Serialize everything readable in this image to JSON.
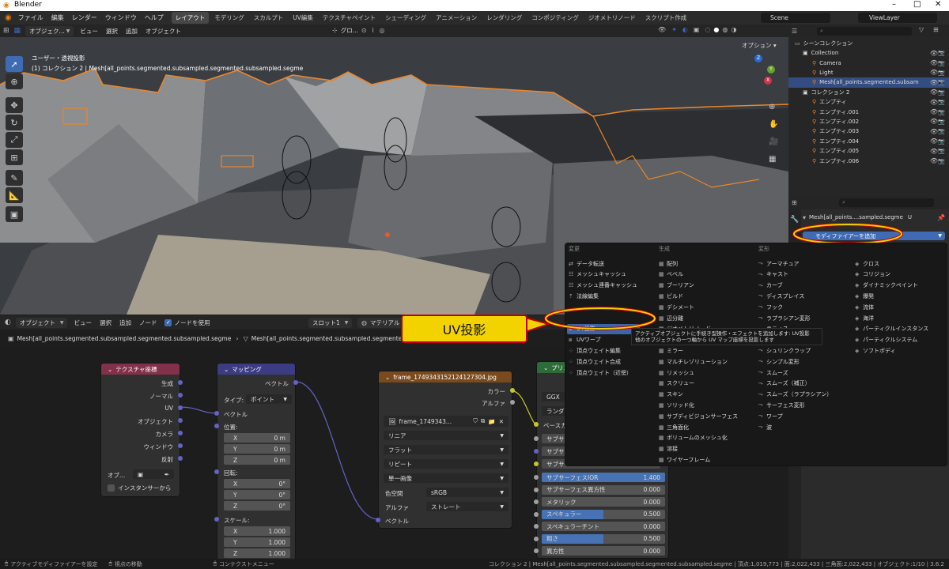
{
  "app": {
    "title": "Blender"
  },
  "window_controls": {
    "minimize": "–",
    "maximize": "□",
    "close": "✕"
  },
  "menu": {
    "items": [
      "ファイル",
      "編集",
      "レンダー",
      "ウィンドウ",
      "ヘルプ"
    ],
    "workspaces": [
      "レイアウト",
      "モデリング",
      "スカルプト",
      "UV編集",
      "テクスチャペイント",
      "シェーディング",
      "アニメーション",
      "レンダリング",
      "コンポジティング",
      "ジオメトリノード",
      "スクリプト作成"
    ],
    "active_workspace": "レイアウト",
    "scene": "Scene",
    "view_layer": "ViewLayer"
  },
  "viewport": {
    "mode": "オブジェク...",
    "header_menus": [
      "ビュー",
      "選択",
      "追加",
      "オブジェクト"
    ],
    "transform_orientation": "グロ...",
    "options_label": "オプション",
    "view_name": "ユーザー・透視投影",
    "collection_info": "(1) コレクション 2 | Mesh[all_points.segmented.subsampled.segmented.subsampled.segme",
    "gizmo_axes": {
      "z": "Z",
      "y": "Y",
      "x": "X"
    }
  },
  "outliner": {
    "title": "シーンコレクション",
    "items": [
      {
        "label": "Collection",
        "depth": 1
      },
      {
        "label": "Camera",
        "depth": 2
      },
      {
        "label": "Light",
        "depth": 2
      },
      {
        "label": "Mesh[all_points.segmented.subsam",
        "depth": 2,
        "selected": true
      },
      {
        "label": "コレクション 2",
        "depth": 1
      },
      {
        "label": "エンプティ",
        "depth": 2
      },
      {
        "label": "エンプティ.001",
        "depth": 2
      },
      {
        "label": "エンプティ.002",
        "depth": 2
      },
      {
        "label": "エンプティ.003",
        "depth": 2
      },
      {
        "label": "エンプティ.004",
        "depth": 2
      },
      {
        "label": "エンプティ.005",
        "depth": 2
      },
      {
        "label": "エンプティ.006",
        "depth": 2
      }
    ]
  },
  "properties": {
    "object_name": "Mesh[all_points....sampled.segme",
    "object_suffix": "U",
    "add_modifier": "モディファイアーを追加"
  },
  "modifier_menu": {
    "columns": [
      {
        "header": "変更",
        "items": [
          "データ転送",
          "メッシュキャッシュ",
          "メッシュ連番キャッシュ",
          "法線編集",
          "",
          "",
          "UV投影",
          "UVワープ",
          "頂点ウェイト編集",
          "頂点ウェイト合成",
          "頂点ウェイト（近傍）"
        ]
      },
      {
        "header": "生成",
        "items": [
          "配列",
          "ベベル",
          "ブーリアン",
          "ビルド",
          "デシメート",
          "辺分離",
          "ジオメトリノード",
          "マスク",
          "ミラー",
          "マルチレゾリューション",
          "リメッシュ",
          "スクリュー",
          "スキン",
          "ソリッド化",
          "サブディビジョンサーフェス",
          "三角面化",
          "ボリュームのメッシュ化",
          "溶接",
          "ワイヤーフレーム"
        ]
      },
      {
        "header": "変形",
        "items": [
          "アーマチュア",
          "キャスト",
          "カーブ",
          "ディスプレイス",
          "フック",
          "ラプラシアン変形",
          "ラティス",
          "メッシュ変形",
          "シュリンクラップ",
          "シンプル変形",
          "スムーズ",
          "スムーズ（補正）",
          "スムーズ（ラプラシアン）",
          "サーフェス変形",
          "ワープ",
          "波"
        ]
      },
      {
        "header": "",
        "items": [
          "クロス",
          "コリジョン",
          "ダイナミックペイント",
          "爆発",
          "流体",
          "海洋",
          "パーティクルインスタンス",
          "パーティクルシステム",
          "ソフトボディ"
        ]
      }
    ],
    "highlighted": "UV投影",
    "tooltip_line1": "アクティブオブジェクトに手続き型操作・エフェクトを追加します: UV投影",
    "tooltip_line2": "他のオブジェクトの一つ軸から UV マップ座標を投影します"
  },
  "callout": {
    "text": "UV投影"
  },
  "node_editor": {
    "header": {
      "mode": "オブジェクト",
      "menus": [
        "ビュー",
        "選択",
        "追加",
        "ノード"
      ],
      "use_nodes": "ノードを使用",
      "slot": "スロット1",
      "material": "マテリアル"
    },
    "breadcrumb_object": "Mesh[all_points.segmented.subsampled.segmented.subsampled.segme",
    "breadcrumb_mesh": "Mesh[all_points.segmented.subsampled.segmented.subsampled.segme",
    "texcoord": {
      "title": "テクスチャ座標",
      "outputs": [
        "生成",
        "ノーマル",
        "UV",
        "オブジェクト",
        "カメラ",
        "ウィンドウ",
        "反射"
      ],
      "object_label": "オブ...",
      "instancer": "インスタンサーから"
    },
    "mapping": {
      "title": "マッピング",
      "output": "ベクトル",
      "type_label": "タイプ:",
      "type_value": "ポイント",
      "vector": "ベクトル",
      "location": "位置:",
      "rotation": "回転:",
      "scale": "スケール:",
      "loc": [
        {
          "a": "X",
          "v": "0 m"
        },
        {
          "a": "Y",
          "v": "0 m"
        },
        {
          "a": "Z",
          "v": "0 m"
        }
      ],
      "rot": [
        {
          "a": "X",
          "v": "0°"
        },
        {
          "a": "Y",
          "v": "0°"
        },
        {
          "a": "Z",
          "v": "0°"
        }
      ],
      "scl": [
        {
          "a": "X",
          "v": "1.000"
        },
        {
          "a": "Y",
          "v": "1.000"
        },
        {
          "a": "Z",
          "v": "1.000"
        }
      ]
    },
    "image": {
      "title": "frame_1749343152124127304.jpg",
      "outputs": [
        "カラー",
        "アルファ"
      ],
      "image_name": "frame_1749343...",
      "interp": "リニア",
      "proj": "フラット",
      "ext": "リピート",
      "source": "単一画像",
      "cs_label": "色空間",
      "cs_value": "sRGB",
      "alpha_label": "アルファ",
      "alpha_value": "ストレート",
      "vector": "ベクトル"
    },
    "bsdf": {
      "title": "プリンシ...",
      "distribution": "GGX",
      "ssm": "ランダ...",
      "base_color": "ベースカ...",
      "rows": [
        "サブサ...",
        "サブサ...",
        "サブサー..."
      ],
      "props": [
        {
          "label": "サブサーフェスIOR",
          "value": "1.400",
          "fill": 1.0
        },
        {
          "label": "サブサーフェス異方性",
          "value": "0.000",
          "fill": 0
        },
        {
          "label": "メタリック",
          "value": "0.000",
          "fill": 0
        },
        {
          "label": "スペキュラー",
          "value": "0.500",
          "fill": 0.5
        },
        {
          "label": "スペキュラーチント",
          "value": "0.000",
          "fill": 0
        },
        {
          "label": "粗さ",
          "value": "0.500",
          "fill": 0.5
        },
        {
          "label": "異方性",
          "value": "0.000",
          "fill": 0
        }
      ]
    }
  },
  "statusbar": {
    "left1": "アクティブモディファイアーを設定",
    "left2": "視点の移動",
    "left3": "コンテクストメニュー",
    "right": "コレクション 2 | Mesh[all_points.segmented.subsampled.segmented.subsampled.segme | 頂点:1,019,773 | 面:2,022,433 | 三角面:2,022,433 | オブジェクト:1/10 | 3.6.2"
  },
  "colors": {
    "accent": "#3f6bb5",
    "highlight_ring": "#f4d000",
    "callout_border": "#c20000",
    "selection_outline": "#e8862b"
  }
}
